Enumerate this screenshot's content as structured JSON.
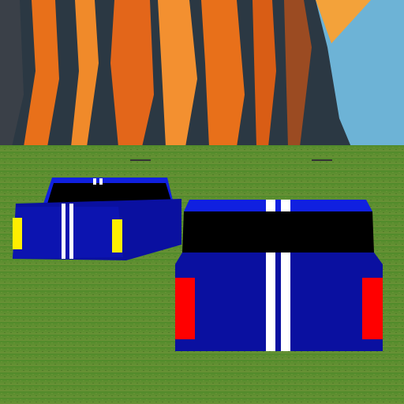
{
  "scene": {
    "sky_color": "#6db3d6",
    "lava_color": "#f07a1a",
    "rock_color": "#2a3640",
    "grass_color": "#5c8d2c",
    "car_body_color": "#0a10a0",
    "car_roof_color": "#1020e0",
    "windshield_color": "#000000",
    "stripe_color": "#ffffff",
    "left_car_light_color": "#ffee00",
    "right_car_light_color": "#ff0000"
  }
}
